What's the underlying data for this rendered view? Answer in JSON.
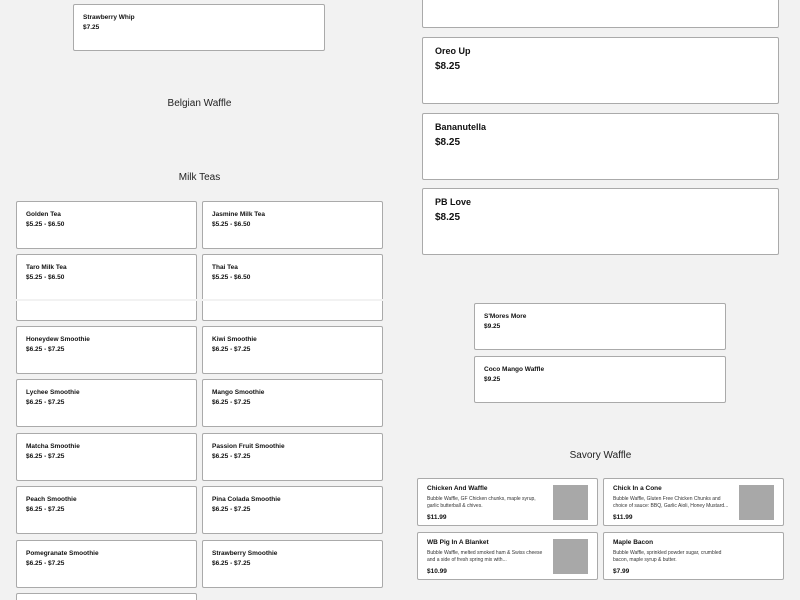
{
  "top_left": {
    "strawberry_whip": {
      "name": "Strawberry Whip",
      "price": "$7.25"
    },
    "belgian_title": "Belgian Waffle",
    "milk_teas_title": "Milk Teas",
    "milk_teas": [
      {
        "name": "Golden Tea",
        "price": "$5.25 - $6.50"
      },
      {
        "name": "Jasmine Milk Tea",
        "price": "$5.25 - $6.50"
      },
      {
        "name": "Taro Milk Tea",
        "price": "$5.25 - $6.50"
      },
      {
        "name": "Thai Tea",
        "price": "$5.25 - $6.50"
      }
    ]
  },
  "top_right": {
    "items": [
      {
        "name": "Oreo Up",
        "price": "$8.25"
      },
      {
        "name": "Bananutella",
        "price": "$8.25"
      },
      {
        "name": "PB Love",
        "price": "$8.25"
      }
    ]
  },
  "bottom_left": {
    "smoothies": [
      {
        "name": "Honeydew Smoothie",
        "price": "$6.25 - $7.25"
      },
      {
        "name": "Kiwi Smoothie",
        "price": "$6.25 - $7.25"
      },
      {
        "name": "Lychee Smoothie",
        "price": "$6.25 - $7.25"
      },
      {
        "name": "Mango Smoothie",
        "price": "$6.25 - $7.25"
      },
      {
        "name": "Matcha Smoothie",
        "price": "$6.25 - $7.25"
      },
      {
        "name": "Passion Fruit Smoothie",
        "price": "$6.25 - $7.25"
      },
      {
        "name": "Peach Smoothie",
        "price": "$6.25 - $7.25"
      },
      {
        "name": "Pina Colada Smoothie",
        "price": "$6.25 - $7.25"
      },
      {
        "name": "Pomegranate Smoothie",
        "price": "$6.25 - $7.25"
      },
      {
        "name": "Strawberry Smoothie",
        "price": "$6.25 - $7.25"
      }
    ]
  },
  "bottom_right": {
    "smores": {
      "name": "S'Mores More",
      "price": "$9.25"
    },
    "coco_mango": {
      "name": "Coco Mango Waffle",
      "price": "$9.25"
    },
    "savory_title": "Savory Waffle",
    "savory": [
      {
        "name": "Chicken And Waffle",
        "desc": "Bubble Waffle, GF Chicken chunks, maple syrup, garlic butterball & chives.",
        "price": "$11.99"
      },
      {
        "name": "Chick In a Cone",
        "desc": "Bubble Waffle, Gluten Free Chicken Chunks and choice of sauce: BBQ, Garlic Aioli, Honey Mustard...",
        "price": "$11.99"
      },
      {
        "name": "WB Pig In A Blanket",
        "desc": "Bubble Waffle, melted smoked ham & Swiss cheese and a side of fresh spring mix with...",
        "price": "$10.99"
      },
      {
        "name": "Maple Bacon",
        "desc": "Bubble Waffle, sprinkled powder sugar, crumbled bacon, maple syrup & butter.",
        "price": "$7.99"
      }
    ]
  }
}
